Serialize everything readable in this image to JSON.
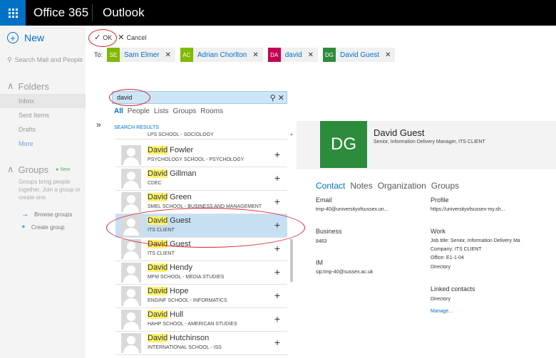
{
  "topbar": {
    "brand": "Office 365",
    "app": "Outlook"
  },
  "leftnav": {
    "new_label": "New",
    "search_placeholder": "Search Mail and People",
    "folders_label": "Folders",
    "folders": [
      "Inbox",
      "Sent Items",
      "Drafts"
    ],
    "more_label": "More",
    "groups_label": "Groups",
    "groups_badge": "New",
    "groups_desc": "Groups bring people together. Join a group or create one.",
    "browse_groups": "Browse groups",
    "create_group": "Create group"
  },
  "compose": {
    "ok_label": "OK",
    "cancel_label": "Cancel",
    "to_label": "To:",
    "recipients": [
      {
        "initials": "SE",
        "name": "Sam Elmer",
        "color": "#7fba00"
      },
      {
        "initials": "AC",
        "name": "Adrian Chorlton",
        "color": "#7fba00"
      },
      {
        "initials": "DA",
        "name": "david",
        "color": "#c30052"
      },
      {
        "initials": "DG",
        "name": "David Guest",
        "color": "#2d8c3c"
      }
    ]
  },
  "search": {
    "query": "david",
    "filters": [
      "All",
      "People",
      "Lists",
      "Groups",
      "Rooms"
    ],
    "results_label": "SEARCH RESULTS",
    "results": [
      {
        "highlight": "",
        "rest": "",
        "sub": "LPS SCHOOL - SOCIOLOGY",
        "cut": true
      },
      {
        "highlight": "David",
        "rest": " Fowler",
        "sub": "PSYCHOLOGY SCHOOL - PSYCHOLOGY"
      },
      {
        "highlight": "David",
        "rest": " Gillman",
        "sub": "CDEC"
      },
      {
        "highlight": "David",
        "rest": " Green",
        "sub": "SMEL SCHOOL - BUSINESS AND MANAGEMENT"
      },
      {
        "highlight": "David",
        "rest": " Guest",
        "sub": "ITS CLIENT",
        "selected": true
      },
      {
        "highlight": "David",
        "rest": " Guest",
        "sub": "ITS CLIENT"
      },
      {
        "highlight": "David",
        "rest": " Hendy",
        "sub": "MFM SCHOOL - MEDIA STUDIES"
      },
      {
        "highlight": "David",
        "rest": " Hope",
        "sub": "ENGINF SCHOOL - INFORMATICS"
      },
      {
        "highlight": "David",
        "rest": " Hull",
        "sub": "HAHP SCHOOL - AMERICAN STUDIES"
      },
      {
        "highlight": "David",
        "rest": " Hutchinson",
        "sub": "INTERNATIONAL SCHOOL - ISS"
      }
    ]
  },
  "card": {
    "initials": "DG",
    "tile_color": "#2d8c3c",
    "name": "David Guest",
    "title": "Senior, Information Delivery Manager, ITS CLIENT",
    "tabs": [
      "Contact",
      "Notes",
      "Organization",
      "Groups"
    ],
    "email_label": "Email",
    "email_value": "tmp-40@universityofsussex.on...",
    "profile_label": "Profile",
    "profile_value": "https://universityofsussex-my.sh...",
    "business_label": "Business",
    "business_value": "8463",
    "work_label": "Work",
    "work_job": "Job title:  Senior, Information Delivery Ma",
    "work_company": "Company:  ITS CLIENT",
    "work_office": "Office:  E1-1-04",
    "work_directory": "Directory",
    "im_label": "IM",
    "im_value": "sip:tmp-40@sussex.ac.uk",
    "linked_label": "Linked contacts",
    "linked_directory": "Directory",
    "manage_label": "Manage..."
  }
}
